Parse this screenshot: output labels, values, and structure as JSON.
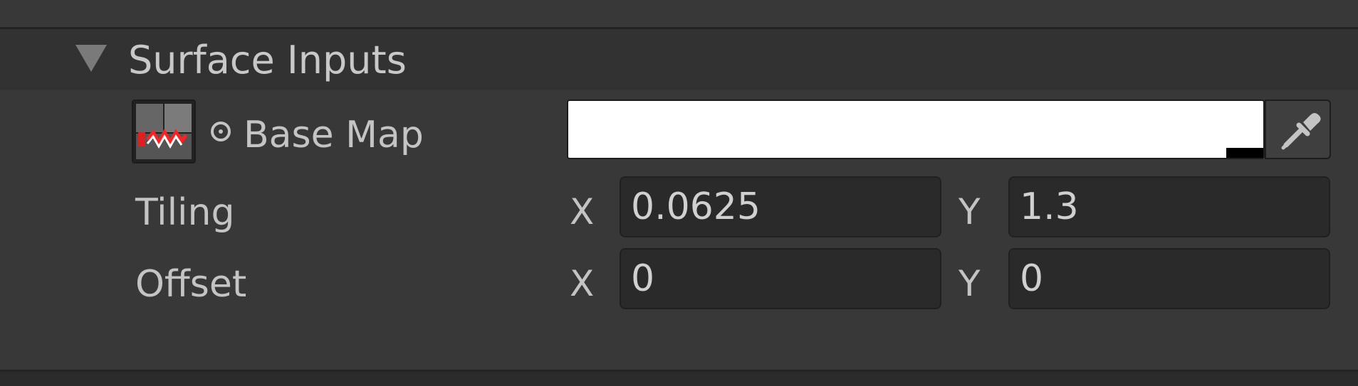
{
  "section": {
    "title": "Surface Inputs"
  },
  "base_map": {
    "label": "Base Map",
    "color_hex": "#FFFFFF"
  },
  "tiling": {
    "label": "Tiling",
    "x_label": "X",
    "x_value": "0.0625",
    "y_label": "Y",
    "y_value": "1.3"
  },
  "offset": {
    "label": "Offset",
    "x_label": "X",
    "x_value": "0",
    "y_label": "Y",
    "y_value": "0"
  }
}
